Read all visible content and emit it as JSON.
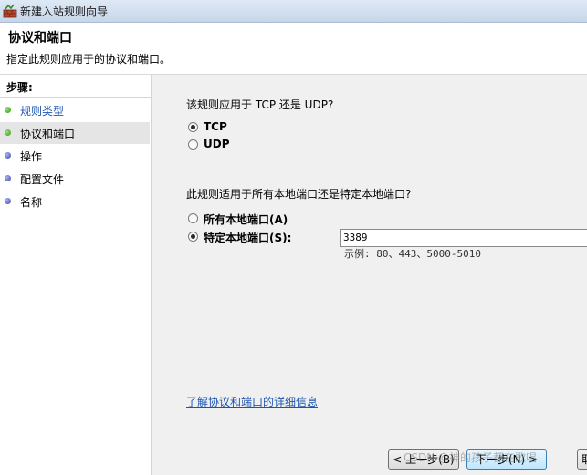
{
  "window": {
    "title": "新建入站规则向导",
    "icon": "firewall-wizard-icon"
  },
  "header": {
    "title": "协议和端口",
    "subtitle": "指定此规则应用于的协议和端口。"
  },
  "sidebar": {
    "heading": "步骤:",
    "steps": [
      {
        "label": "规则类型",
        "state": "done",
        "dot_color": "#2f9a1a"
      },
      {
        "label": "协议和端口",
        "state": "current",
        "dot_color": "#2f9a1a"
      },
      {
        "label": "操作",
        "state": "pending",
        "dot_color": "#3b46a8"
      },
      {
        "label": "配置文件",
        "state": "pending",
        "dot_color": "#3b46a8"
      },
      {
        "label": "名称",
        "state": "pending",
        "dot_color": "#3b46a8"
      }
    ]
  },
  "protocol": {
    "question": "该规则应用于 TCP 还是 UDP?",
    "options": [
      {
        "label": "TCP",
        "checked": true
      },
      {
        "label": "UDP",
        "checked": false
      }
    ]
  },
  "ports": {
    "question": "此规则适用于所有本地端口还是特定本地端口?",
    "options": [
      {
        "label": "所有本地端口(A)",
        "checked": false
      },
      {
        "label": "特定本地端口(S):",
        "checked": true
      }
    ],
    "value": "3389",
    "example": "示例: 80、443、5000-5010"
  },
  "links": {
    "help": "了解协议和端口的详细信息"
  },
  "buttons": {
    "back": "< 上一步(B)",
    "next": "下一步(N) >",
    "cancel": "取"
  },
  "watermark": "CSDN @神的孩子都在歌唱"
}
